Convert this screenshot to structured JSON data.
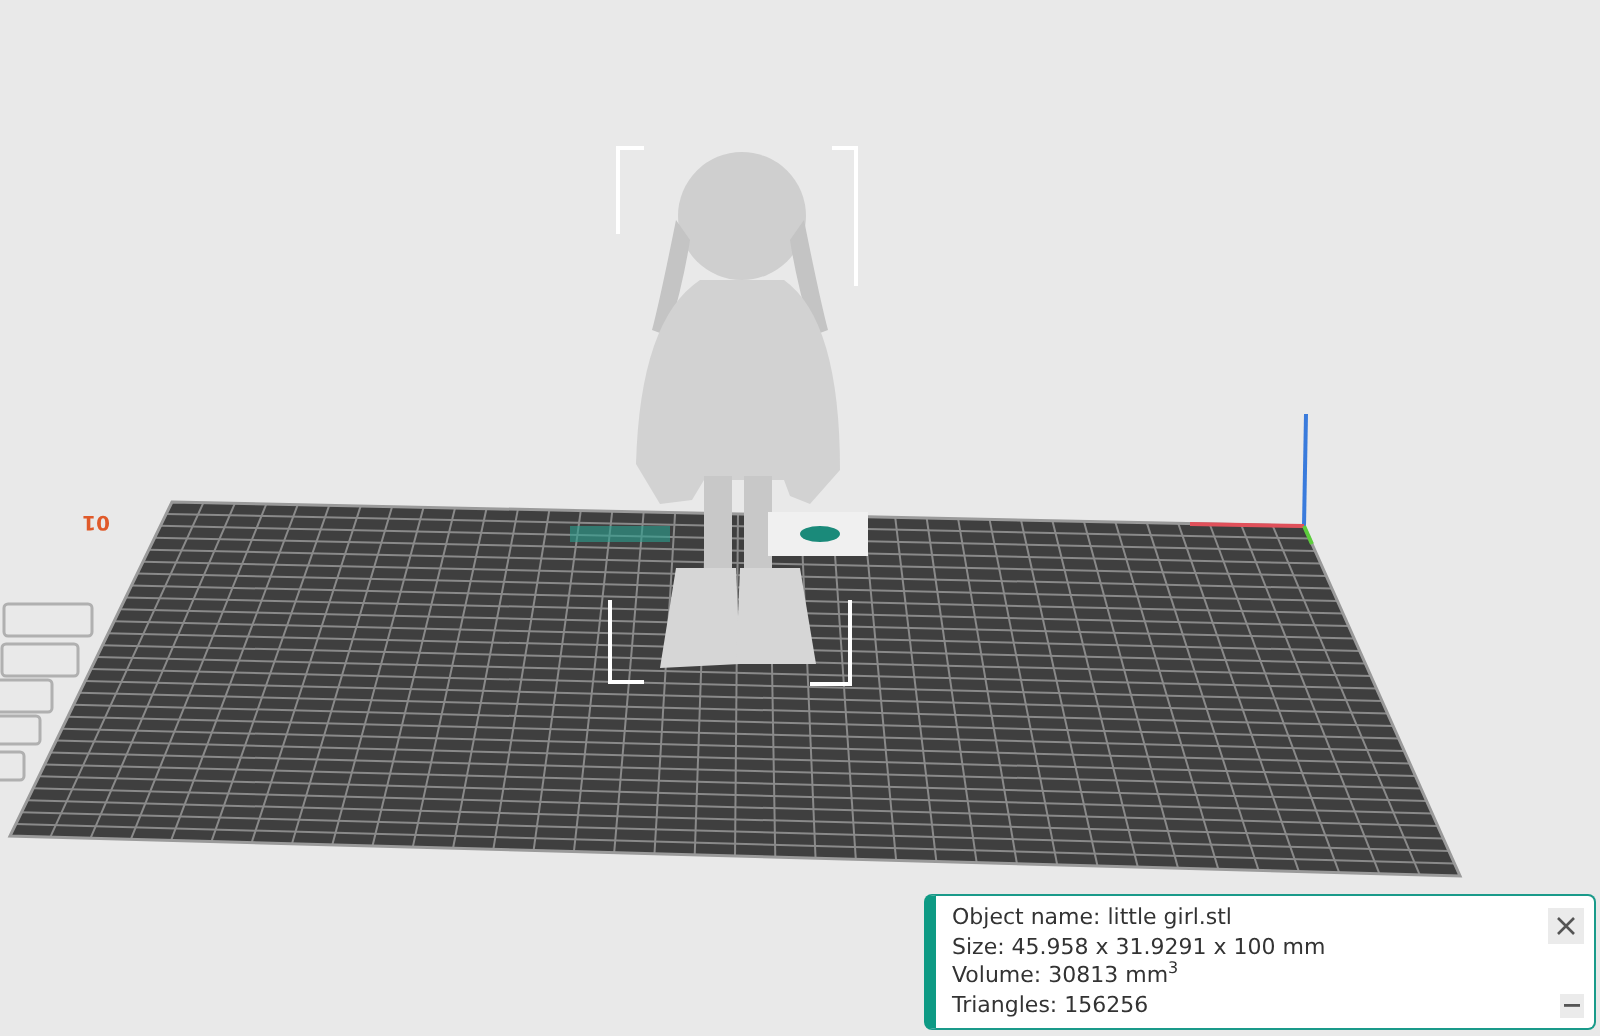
{
  "plate": {
    "label": "01"
  },
  "object_info": {
    "lines": [
      "Object name: little girl.stl",
      "Size: 45.958 x 31.9291 x 100 mm",
      "Volume: 30813 mm$^{3}$",
      "Triangles: 156256"
    ]
  }
}
